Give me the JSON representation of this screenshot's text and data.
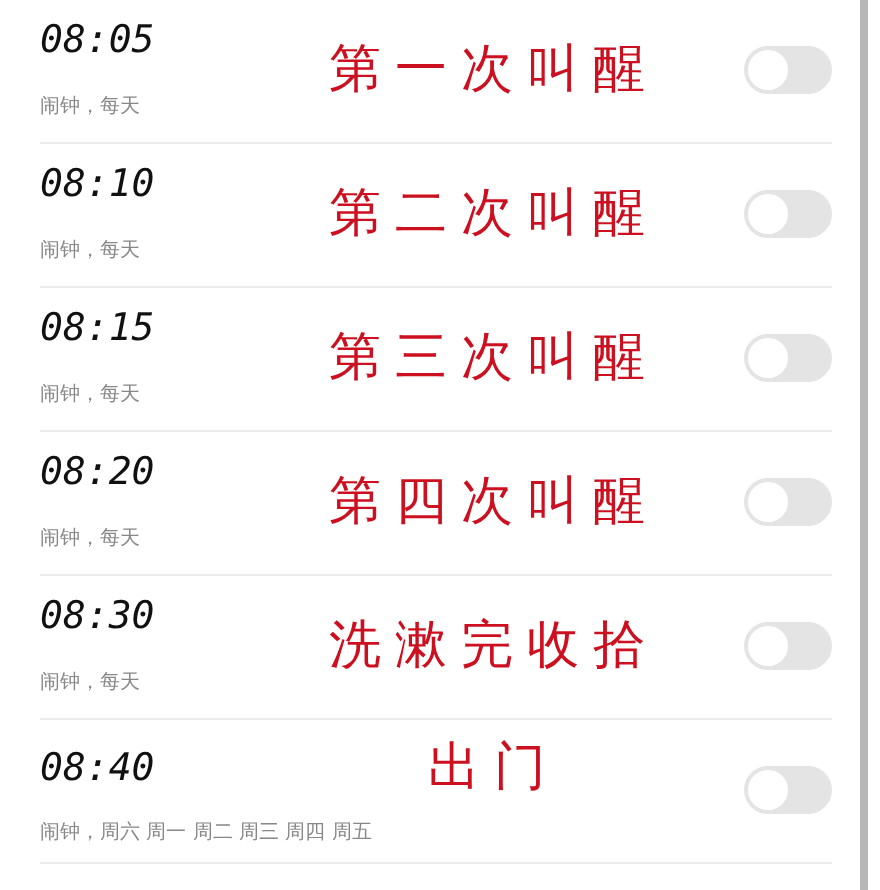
{
  "alarms": [
    {
      "time": "08:05",
      "subtitle": "闹钟，每天",
      "note": "第一次叫醒",
      "on": false
    },
    {
      "time": "08:10",
      "subtitle": "闹钟，每天",
      "note": "第二次叫醒",
      "on": false
    },
    {
      "time": "08:15",
      "subtitle": "闹钟，每天",
      "note": "第三次叫醒",
      "on": false
    },
    {
      "time": "08:20",
      "subtitle": "闹钟，每天",
      "note": "第四次叫醒",
      "on": false
    },
    {
      "time": "08:30",
      "subtitle": "闹钟，每天",
      "note": "洗漱完收拾",
      "on": false
    },
    {
      "time": "08:40",
      "subtitle": "闹钟，周六 周一 周二 周三 周四 周五",
      "note": "出门",
      "on": false
    }
  ]
}
